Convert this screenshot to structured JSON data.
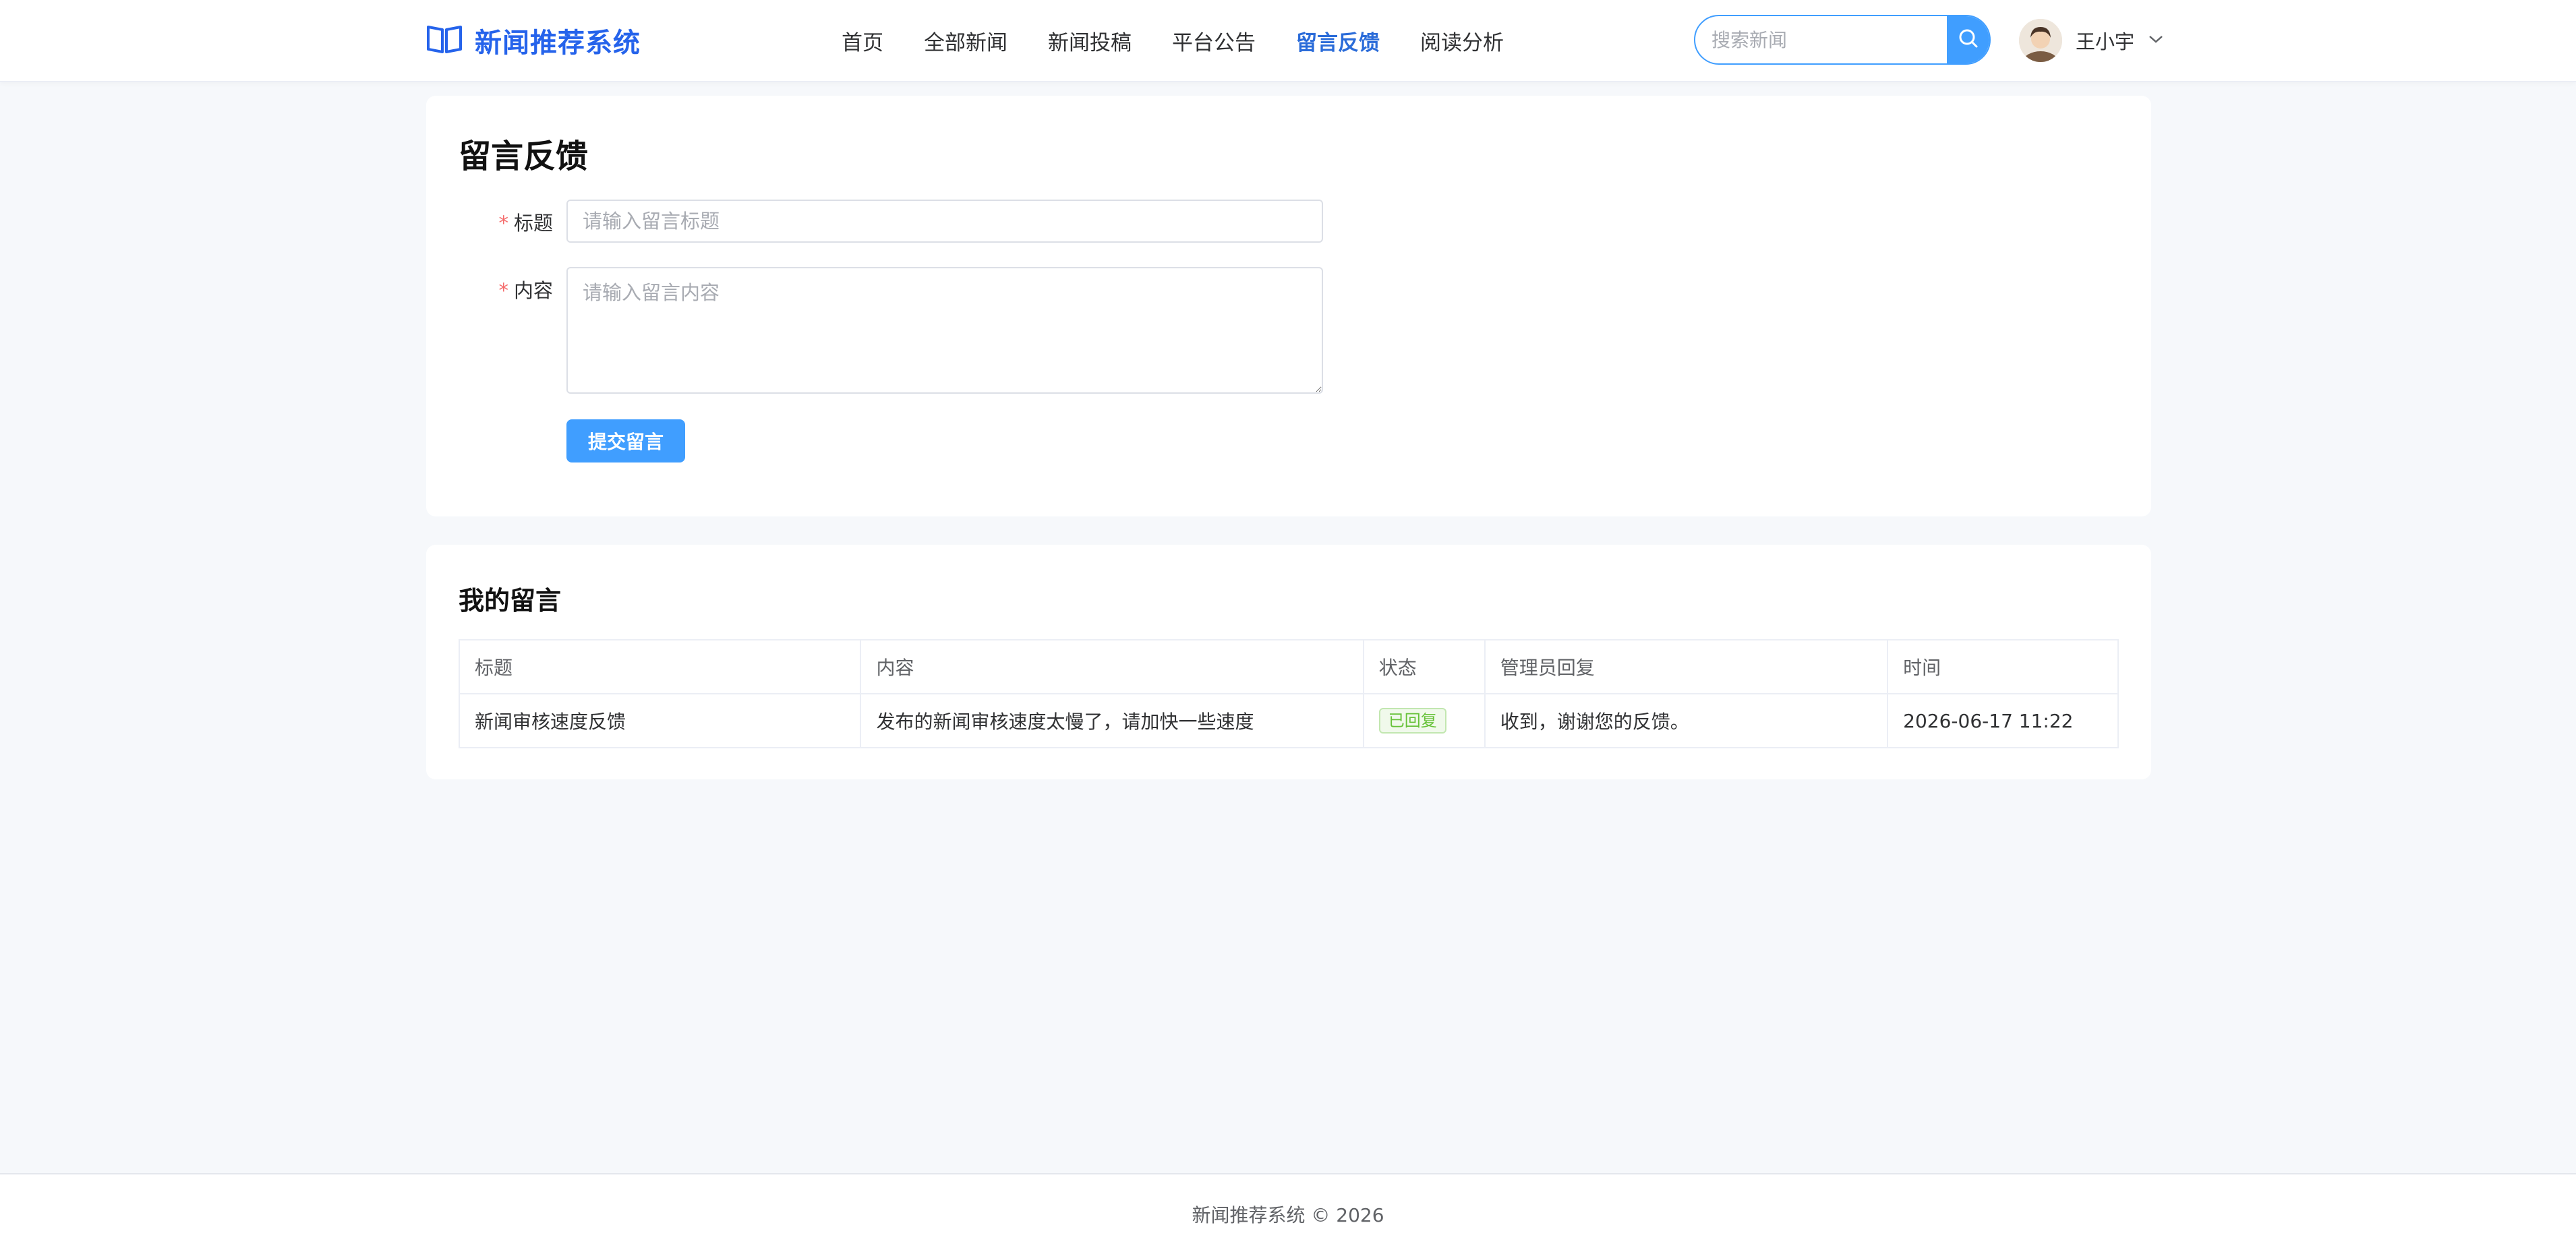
{
  "header": {
    "logo_title": "新闻推荐系统",
    "nav": [
      {
        "label": "首页",
        "active": false
      },
      {
        "label": "全部新闻",
        "active": false
      },
      {
        "label": "新闻投稿",
        "active": false
      },
      {
        "label": "平台公告",
        "active": false
      },
      {
        "label": "留言反馈",
        "active": true
      },
      {
        "label": "阅读分析",
        "active": false
      }
    ],
    "search_placeholder": "搜索新闻",
    "user_name": "王小宇"
  },
  "form": {
    "page_title": "留言反馈",
    "title_label": "标题",
    "title_placeholder": "请输入留言标题",
    "title_value": "",
    "content_label": "内容",
    "content_placeholder": "请输入留言内容",
    "content_value": "",
    "required_mark": "*",
    "submit_label": "提交留言"
  },
  "messages": {
    "section_title": "我的留言",
    "columns": [
      "标题",
      "内容",
      "状态",
      "管理员回复",
      "时间"
    ],
    "rows": [
      {
        "title": "新闻审核速度反馈",
        "content": "发布的新闻审核速度太慢了，请加快一些速度",
        "status": "已回复",
        "reply": "收到，谢谢您的反馈。",
        "time": "2026-06-17 11:22"
      }
    ]
  },
  "footer": {
    "text": "新闻推荐系统 © 2026"
  },
  "colors": {
    "brand": "#2563eb",
    "primary": "#409eff",
    "success": "#67c23a",
    "danger": "#f56c6c",
    "background": "#f6f8fb"
  },
  "icons": {
    "logo": "open-book-icon",
    "search": "search-icon",
    "user_menu": "chevron-down-icon"
  }
}
